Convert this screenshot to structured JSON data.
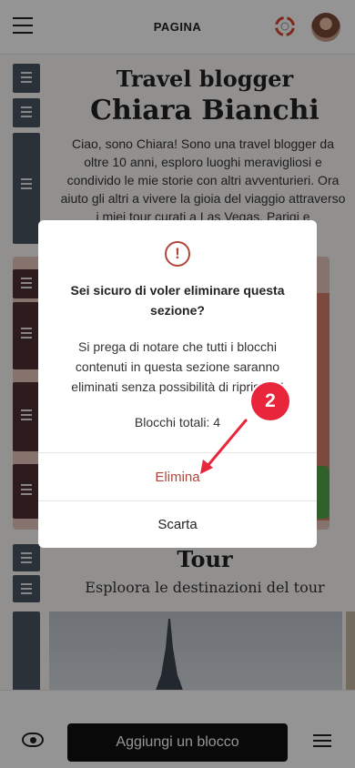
{
  "header": {
    "title": "PAGINA"
  },
  "hero": {
    "title_line1": "Travel blogger",
    "title_line2": "Chiara Bianchi",
    "intro": "Ciao, sono Chiara! Sono una travel blogger da oltre 10 anni, esploro luoghi meravigliosi e condivido le mie storie con altri avventurieri. Ora aiuto gli altri a vivere la gioia del viaggio attraverso i miei tour curati a Las Vegas, Parigi e"
  },
  "tour": {
    "title": "Tour",
    "subtitle": "Esploora le destinazioni del tour"
  },
  "bottom_bar": {
    "add_block_label": "Aggiungi un blocco"
  },
  "dialog": {
    "icon": "!",
    "title": "Sei sicuro di voler eliminare questa sezione?",
    "message": "Si prega di notare che tutti i blocchi\ncontenuti in questa sezione saranno\neliminati senza possibilità di ripristino!",
    "total_blocks": "Blocchi totali: 4",
    "delete_label": "Elimina",
    "discard_label": "Scarta"
  },
  "annotation": {
    "step_number": "2",
    "color": "#e8253a"
  },
  "colors": {
    "danger": "#b2453a",
    "handle": "#4b5562",
    "accent_green": "#56a54d"
  }
}
